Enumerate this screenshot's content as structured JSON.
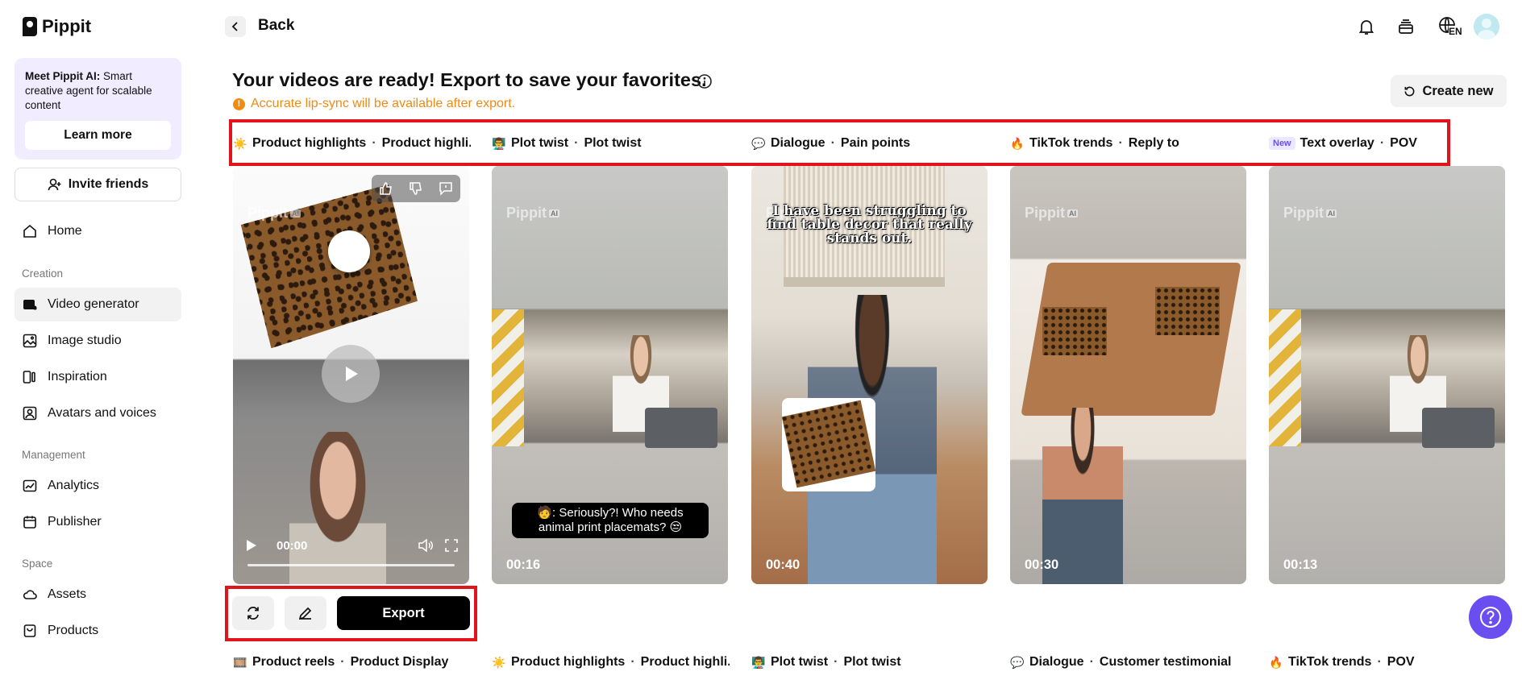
{
  "app": {
    "name": "Pippit"
  },
  "sidebar": {
    "promo": {
      "title": "Meet Pippit AI:",
      "text": " Smart creative agent for scalable content",
      "button": "Learn more"
    },
    "invite": "Invite friends",
    "home": "Home",
    "sections": {
      "creation": "Creation",
      "management": "Management",
      "space": "Space"
    },
    "items": {
      "video_generator": "Video generator",
      "image_studio": "Image studio",
      "inspiration": "Inspiration",
      "avatars": "Avatars and voices",
      "analytics": "Analytics",
      "publisher": "Publisher",
      "assets": "Assets",
      "products": "Products"
    }
  },
  "header": {
    "back": "Back",
    "language": "EN"
  },
  "main": {
    "title": "Your videos are ready! Export to save your favorites.",
    "warning": "Accurate lip-sync will be available after export.",
    "create_new": "Create new",
    "top_styles": [
      {
        "icon": "☀️",
        "style": "Product highlights",
        "sub": "Product highli..."
      },
      {
        "icon": "👨‍🏫",
        "style": "Plot twist",
        "sub": "Plot twist"
      },
      {
        "icon": "💬",
        "style": "Dialogue",
        "sub": "Pain points"
      },
      {
        "icon": "🔥",
        "style": "TikTok trends",
        "sub": "Reply to"
      },
      {
        "badge": "New",
        "style": "Text overlay",
        "sub": "POV"
      }
    ],
    "videos": [
      {
        "time": "00:00",
        "watermark": "Pippit"
      },
      {
        "duration": "00:16",
        "watermark": "Pippit",
        "caption": "🧑: Seriously?! Who needs animal print placemats? 😒"
      },
      {
        "duration": "00:40",
        "watermark": "Pippit",
        "overlay": "I have been struggling to find table decor that really stands out."
      },
      {
        "duration": "00:30",
        "watermark": "Pippit"
      },
      {
        "duration": "00:13",
        "watermark": "Pippit"
      }
    ],
    "watermark_ai": "AI",
    "export": "Export",
    "bottom_styles": [
      {
        "icon": "🎞️",
        "style": "Product reels",
        "sub": "Product Display"
      },
      {
        "icon": "☀️",
        "style": "Product highlights",
        "sub": "Product highli..."
      },
      {
        "icon": "👨‍🏫",
        "style": "Plot twist",
        "sub": "Plot twist"
      },
      {
        "icon": "💬",
        "style": "Dialogue",
        "sub": "Customer testimonial"
      },
      {
        "icon": "🔥",
        "style": "TikTok trends",
        "sub": "POV"
      }
    ]
  },
  "colors": {
    "accent_purple": "#6a4ef0",
    "warning_orange": "#f08a13",
    "highlight_red": "#e0141a"
  }
}
